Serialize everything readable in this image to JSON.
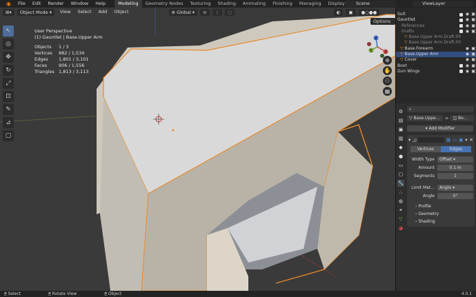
{
  "menu": {
    "items": [
      "File",
      "Edit",
      "Render",
      "Window",
      "Help"
    ],
    "workspaces": [
      "Modeling",
      "Geometry Nodes",
      "Texturing",
      "Shading",
      "Animating",
      "Finishing",
      "Managing",
      "Displaying"
    ],
    "active_workspace": "Modeling",
    "scene": "Scene",
    "view_layer": "ViewLayer"
  },
  "viewport": {
    "mode": "Object Mode",
    "menus": [
      "View",
      "Select",
      "Add",
      "Object"
    ],
    "transform_orientation": "Global",
    "options_label": "Options",
    "view_name": "User Perspective",
    "object_info": "(1) Gauntlet | Base.Upper Arm",
    "stats": [
      {
        "label": "Objects",
        "value": "1 / 3"
      },
      {
        "label": "Vertices",
        "value": "882 / 1,534"
      },
      {
        "label": "Edges",
        "value": "1,801 / 3,101"
      },
      {
        "label": "Faces",
        "value": "906 / 1,556"
      },
      {
        "label": "Triangles",
        "value": "1,813 / 3,113"
      }
    ],
    "gizmo_axes": {
      "x": "X",
      "y": "Y",
      "z": "Z"
    }
  },
  "outliner": {
    "rows": [
      {
        "label": "Suit",
        "style": "normal"
      },
      {
        "label": "Gauntlet",
        "style": "normal"
      },
      {
        "label": "References",
        "style": "dim"
      },
      {
        "label": "Drafts",
        "style": "dim"
      },
      {
        "label": "Base.Upper Arm.Draft.00",
        "style": "dim"
      },
      {
        "label": "Base.Upper Arm.Draft.00",
        "style": "dim"
      },
      {
        "label": "Base.Forearm",
        "style": "normal"
      },
      {
        "label": "Base.Upper Arm",
        "style": "sel"
      },
      {
        "label": "Cover",
        "style": "normal"
      },
      {
        "label": "Boot",
        "style": "normal"
      },
      {
        "label": "Gun Wings",
        "style": "normal"
      }
    ]
  },
  "properties": {
    "object_name": "Base.Uppe...",
    "modifier_short": "Be...",
    "add_modifier": "Add Modifier",
    "affect_tabs": [
      "Vertices",
      "Edges"
    ],
    "affect_active": "Edges",
    "fields": [
      {
        "label": "Width Type",
        "value": "Offset"
      },
      {
        "label": "Amount",
        "value": "0.1 m"
      },
      {
        "label": "Segments",
        "value": "1"
      },
      {
        "label": "Limit Met...",
        "value": "Angle"
      },
      {
        "label": "Angle",
        "value": "0°"
      }
    ],
    "subpanels": [
      "Profile",
      "Geometry",
      "Shading"
    ]
  },
  "status": {
    "items": [
      "Select",
      "Rotate View",
      "Object"
    ],
    "version": "4.0.1"
  }
}
